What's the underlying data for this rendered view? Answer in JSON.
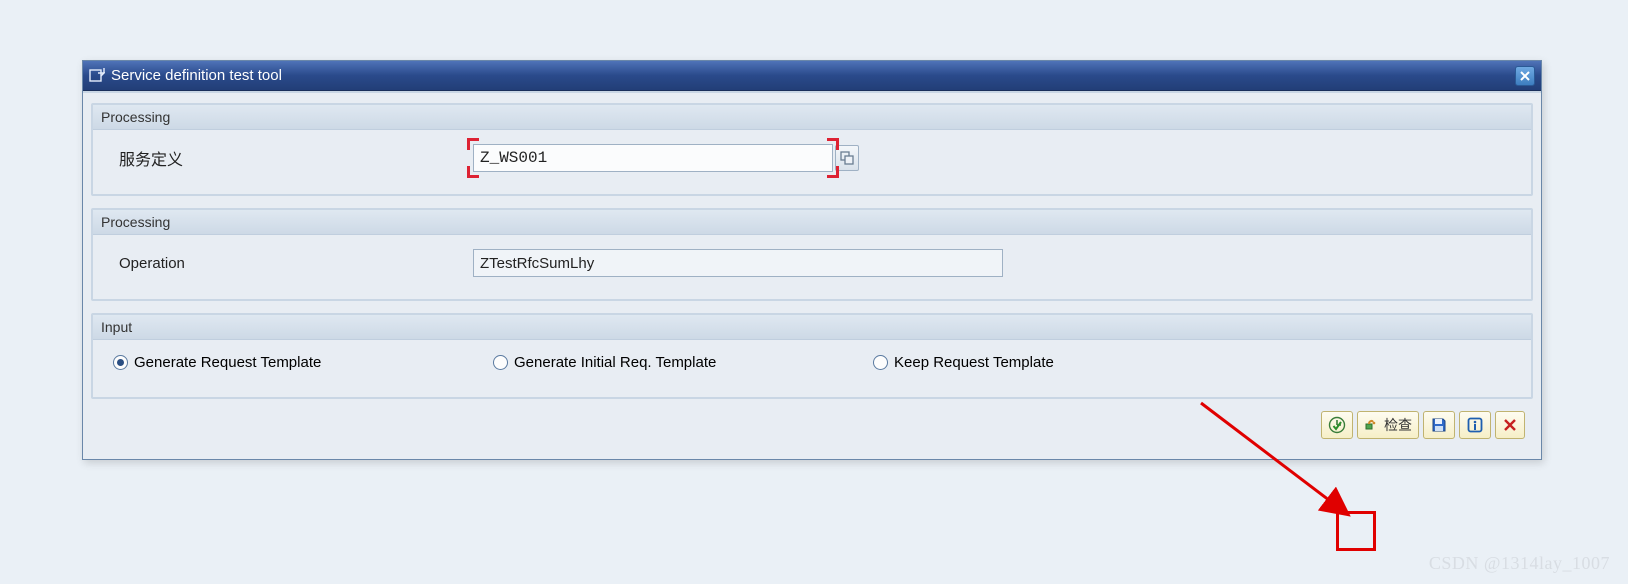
{
  "window": {
    "title": "Service definition test tool"
  },
  "group1": {
    "header": "Processing",
    "label_service_def": "服务定义",
    "service_def_value": "Z_WS001"
  },
  "group2": {
    "header": "Processing",
    "label_operation": "Operation",
    "operation_value": "ZTestRfcSumLhy"
  },
  "group3": {
    "header": "Input",
    "radios": {
      "gen_req": "Generate Request Template",
      "gen_init": "Generate Initial Req. Template",
      "keep_req": "Keep Request Template"
    },
    "selected": "gen_req"
  },
  "footer": {
    "check_label": "检查"
  },
  "watermark": "CSDN @1314lay_1007"
}
